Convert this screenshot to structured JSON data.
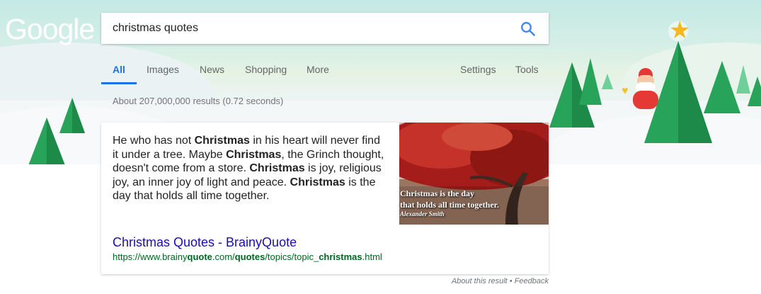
{
  "logo": {
    "text": "Google"
  },
  "search": {
    "query": "christmas quotes",
    "icon": "search-icon"
  },
  "tabs": [
    {
      "label": "All",
      "active": true
    },
    {
      "label": "Images"
    },
    {
      "label": "News"
    },
    {
      "label": "Shopping"
    },
    {
      "label": "More"
    },
    {
      "label": "Settings"
    },
    {
      "label": "Tools"
    }
  ],
  "stats": "About 207,000,000 results (0.72 seconds)",
  "snippet": {
    "segments": [
      {
        "text": "He who has not "
      },
      {
        "text": "Christmas",
        "bold": true
      },
      {
        "text": " in his heart will never find it under a tree. Maybe "
      },
      {
        "text": "Christmas",
        "bold": true
      },
      {
        "text": ", the Grinch thought, doesn't come from a store. "
      },
      {
        "text": "Christmas",
        "bold": true
      },
      {
        "text": " is joy, religious joy, an inner joy of light and peace. "
      },
      {
        "text": "Christmas",
        "bold": true
      },
      {
        "text": " is the day that holds all time together."
      }
    ],
    "image_caption_line1": "Christmas is the day",
    "image_caption_line2": "that holds all time together.",
    "image_caption_author": "Alexander Smith"
  },
  "result": {
    "title": "Christmas Quotes - BrainyQuote",
    "url_segments": [
      {
        "text": "https://www.brainy"
      },
      {
        "text": "quote",
        "bold": true
      },
      {
        "text": ".com/"
      },
      {
        "text": "quotes",
        "bold": true
      },
      {
        "text": "/topics/topic_"
      },
      {
        "text": "christmas",
        "bold": true
      },
      {
        "text": ".html"
      }
    ]
  },
  "footer": {
    "about": "About this result",
    "separator": " • ",
    "feedback": "Feedback"
  },
  "colors": {
    "accent": "#1a73e8",
    "link": "#1a0dab",
    "url": "#006621"
  }
}
